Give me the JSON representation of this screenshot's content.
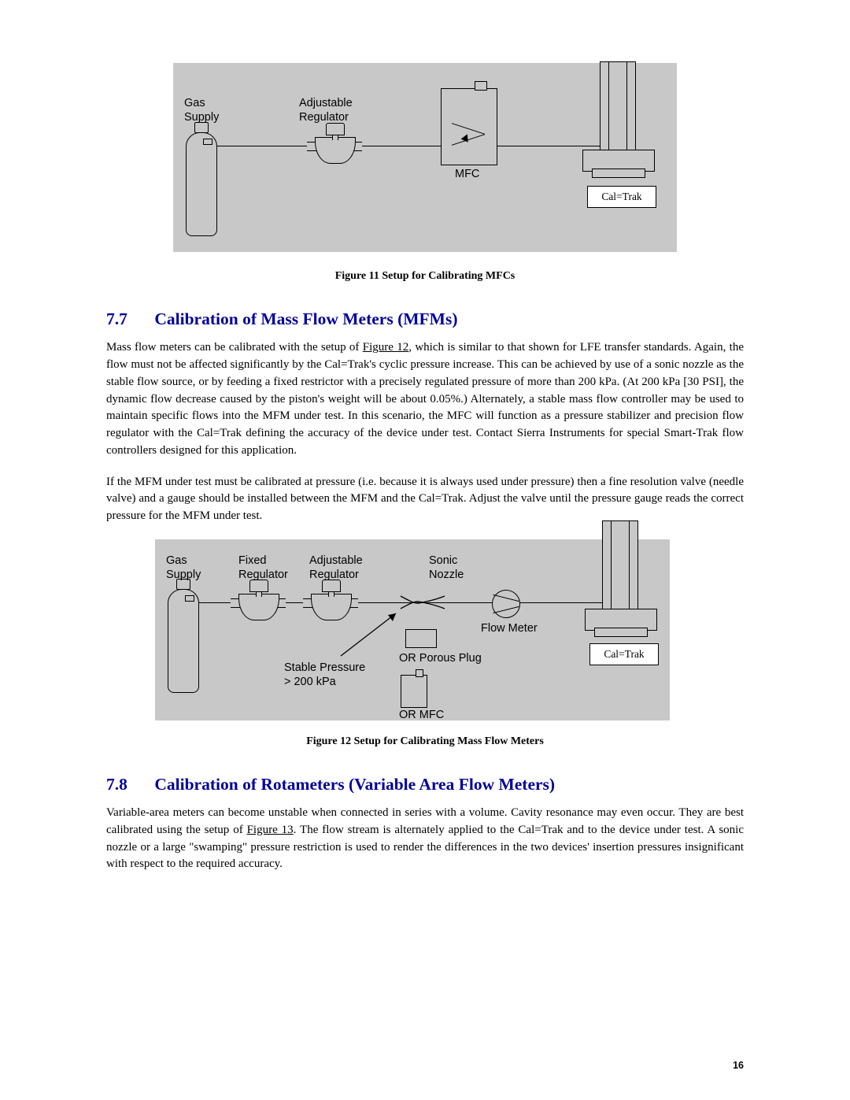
{
  "fig11": {
    "gas_supply1": "Gas",
    "gas_supply2": "Supply",
    "adj_reg1": "Adjustable",
    "adj_reg2": "Regulator",
    "mfc": "MFC",
    "caltrak": "Cal=Trak",
    "caption": "Figure 11  Setup for Calibrating MFCs"
  },
  "sec77": {
    "num": "7.7",
    "title": "Calibration of Mass Flow Meters (MFMs)",
    "p1a": "Mass flow meters can be calibrated with the setup of ",
    "p1link": "Figure 12",
    "p1b": ", which is similar to that shown for LFE transfer standards. Again, the flow must not be affected significantly by the Cal=Trak's cyclic pressure increase. This can be achieved by use of a sonic nozzle as the stable flow source, or by feeding a fixed restrictor with a precisely regulated pressure of more than 200 kPa. (At 200 kPa [30 PSI], the dynamic flow decrease caused by the piston's weight will be about 0.05%.)  Alternately, a stable mass flow controller may be used to maintain specific flows into the MFM under test.  In this scenario, the MFC will function as a pressure stabilizer and precision flow regulator with the Cal=Trak defining the accuracy of the device under test.  Contact Sierra Instruments for special Smart-Trak flow controllers designed for this application.",
    "p2": "If the MFM under test must be calibrated at pressure (i.e. because it is always used under pressure) then a fine resolution valve (needle valve) and a gauge should be installed between the MFM and the Cal=Trak.  Adjust the valve until the pressure gauge reads the correct pressure for the MFM under test."
  },
  "fig12": {
    "gas_supply1": "Gas",
    "gas_supply2": "Supply",
    "fixed_reg1": "Fixed",
    "fixed_reg2": "Regulator",
    "adj_reg1": "Adjustable",
    "adj_reg2": "Regulator",
    "sonic1": "Sonic",
    "sonic2": "Nozzle",
    "flow_meter": "Flow Meter",
    "caltrak": "Cal=Trak",
    "stable1": "Stable Pressure",
    "stable2": "> 200 kPa",
    "orplug": "OR Porous Plug",
    "ormfc": "OR MFC",
    "caption": "Figure 12  Setup for Calibrating Mass Flow Meters"
  },
  "sec78": {
    "num": "7.8",
    "title": "Calibration of Rotameters (Variable Area Flow Meters)",
    "p1a": "Variable-area meters can become unstable when connected in series with a volume. Cavity resonance may even occur. They are best calibrated using the setup of ",
    "p1link": "Figure 13",
    "p1b": ". The flow stream is alternately applied to the Cal=Trak and to the device under test. A sonic nozzle or a large \"swamping\" pressure restriction is used to render the differences in the two devices' insertion pressures insignificant with respect to the required accuracy."
  },
  "pagenum": "16"
}
